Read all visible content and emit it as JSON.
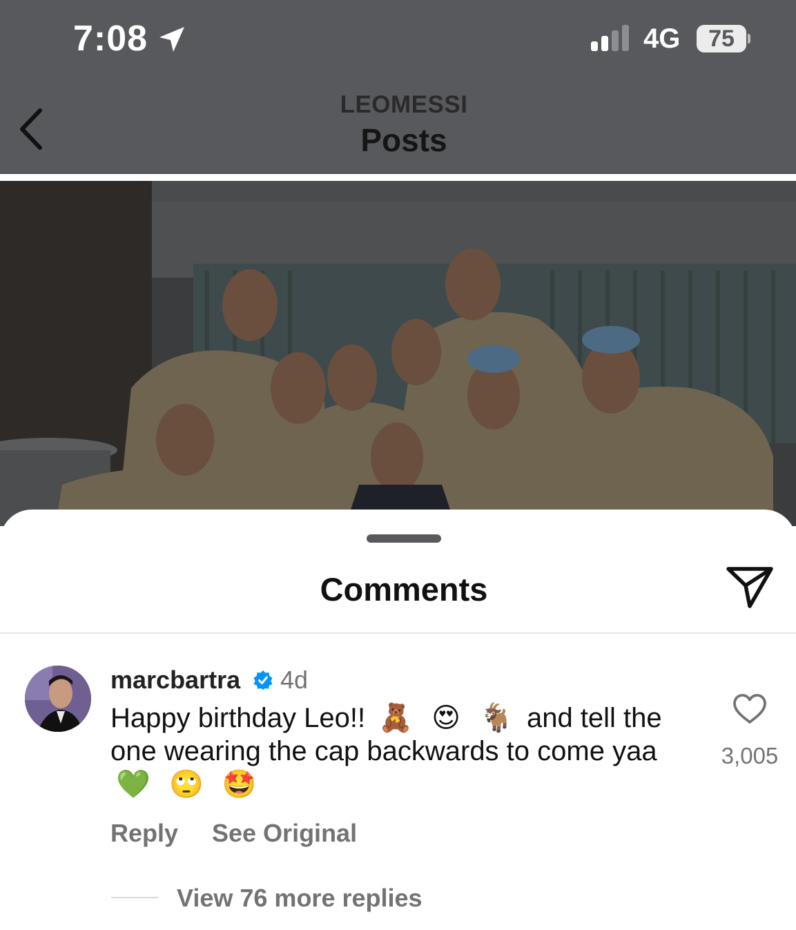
{
  "status_bar": {
    "time": "7:08",
    "network": "4G",
    "battery": "75",
    "location_icon": "location-arrow-icon",
    "signal_icon": "cellular-signal-icon"
  },
  "nav": {
    "account": "LEOMESSI",
    "title": "Posts",
    "back_icon": "chevron-left-icon"
  },
  "post": {
    "image": "group-photo"
  },
  "comments_sheet": {
    "title": "Comments",
    "share_icon": "send-icon",
    "comment": {
      "username": "marcbartra",
      "verified": true,
      "time_ago": "4d",
      "text_part1": "Happy birthday Leo!!",
      "emoji1": "🧸",
      "emoji2": "😍",
      "emoji3": "🐐",
      "text_part2": "and tell the one wearing the cap backwards to come yaa",
      "emoji4": "💚",
      "emoji5": "🙄",
      "emoji6": "🤩",
      "likes": "3,005",
      "reply_label": "Reply",
      "see_original_label": "See Original",
      "view_replies_label": "View 76 more replies"
    }
  },
  "colors": {
    "overlay": "#58595d",
    "verified": "#0095f6",
    "muted_text": "#737373"
  }
}
